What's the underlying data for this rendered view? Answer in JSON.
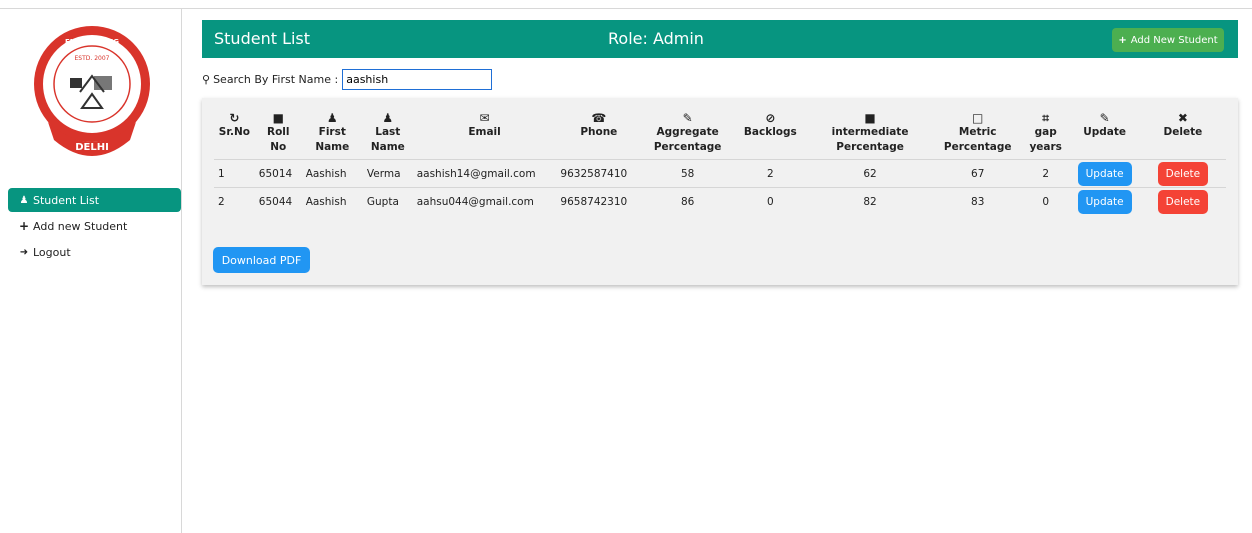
{
  "sidebar": {
    "logo_text": {
      "top": "G.B. PANT ENGINEERING COLLEGE",
      "estd": "ESTD. 2007",
      "bottom": "DELHI"
    },
    "items": [
      {
        "label": "Student List",
        "icon": "user-icon",
        "active": true
      },
      {
        "label": "Add new Student",
        "icon": "plus-icon",
        "active": false
      },
      {
        "label": "Logout",
        "icon": "logout-icon",
        "active": false
      }
    ]
  },
  "header": {
    "title": "Student List",
    "role": "Role: Admin",
    "add_button": "Add New Student"
  },
  "search": {
    "label": "Search By First Name :",
    "value": "aashish"
  },
  "table": {
    "columns": [
      {
        "icon": "refresh-icon",
        "line1": "Sr.No",
        "line2": ""
      },
      {
        "icon": "file-icon",
        "line1": "Roll",
        "line2": "No"
      },
      {
        "icon": "user-icon",
        "line1": "First",
        "line2": "Name"
      },
      {
        "icon": "user-icon",
        "line1": "Last",
        "line2": "Name"
      },
      {
        "icon": "envelope-icon",
        "line1": "Email",
        "line2": ""
      },
      {
        "icon": "phone-icon",
        "line1": "Phone",
        "line2": ""
      },
      {
        "icon": "pencil-icon",
        "line1": "Aggregate",
        "line2": "Percentage"
      },
      {
        "icon": "ban-icon",
        "line1": "Backlogs",
        "line2": ""
      },
      {
        "icon": "file-icon",
        "line1": "intermediate",
        "line2": "Percentage"
      },
      {
        "icon": "file-outline-icon",
        "line1": "Metric",
        "line2": "Percentage"
      },
      {
        "icon": "crop-icon",
        "line1": "gap",
        "line2": "years"
      },
      {
        "icon": "pencil-icon",
        "line1": "Update",
        "line2": ""
      },
      {
        "icon": "trash-icon",
        "line1": "Delete",
        "line2": ""
      }
    ],
    "rows": [
      {
        "sr": "1",
        "roll": "65014",
        "first": "Aashish",
        "last": "Verma",
        "email": "aashish14@gmail.com",
        "phone": "9632587410",
        "aggregate": "58",
        "backlogs": "2",
        "intermediate": "62",
        "metric": "67",
        "gap": "2",
        "update": "Update",
        "delete": "Delete"
      },
      {
        "sr": "2",
        "roll": "65044",
        "first": "Aashish",
        "last": "Gupta",
        "email": "aahsu044@gmail.com",
        "phone": "9658742310",
        "aggregate": "86",
        "backlogs": "0",
        "intermediate": "82",
        "metric": "83",
        "gap": "0",
        "update": "Update",
        "delete": "Delete"
      }
    ]
  },
  "download_button": "Download PDF",
  "colors": {
    "primary": "#079580",
    "add_green": "#4caf50",
    "blue": "#2196f3",
    "red": "#f44336"
  }
}
